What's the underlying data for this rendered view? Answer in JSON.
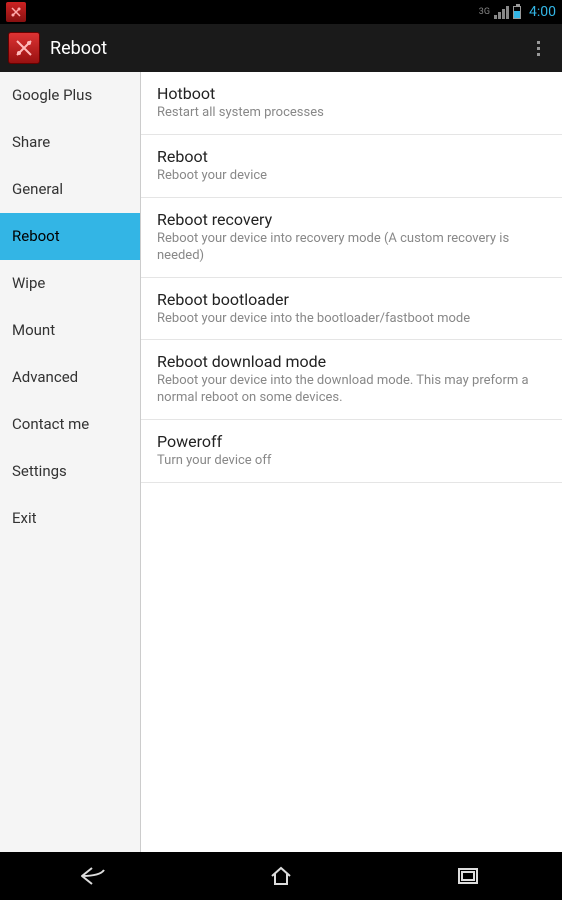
{
  "status": {
    "time": "4:00",
    "network_label": "3G"
  },
  "header": {
    "title": "Reboot"
  },
  "sidebar": {
    "items": [
      {
        "label": "Google Plus",
        "selected": false
      },
      {
        "label": "Share",
        "selected": false
      },
      {
        "label": "General",
        "selected": false
      },
      {
        "label": "Reboot",
        "selected": true
      },
      {
        "label": "Wipe",
        "selected": false
      },
      {
        "label": "Mount",
        "selected": false
      },
      {
        "label": "Advanced",
        "selected": false
      },
      {
        "label": "Contact me",
        "selected": false
      },
      {
        "label": "Settings",
        "selected": false
      },
      {
        "label": "Exit",
        "selected": false
      }
    ]
  },
  "main": {
    "items": [
      {
        "title": "Hotboot",
        "subtitle": "Restart all system processes"
      },
      {
        "title": "Reboot",
        "subtitle": "Reboot your device"
      },
      {
        "title": "Reboot recovery",
        "subtitle": "Reboot your device into recovery mode (A custom recovery is needed)"
      },
      {
        "title": "Reboot bootloader",
        "subtitle": "Reboot your device into the bootloader/fastboot mode"
      },
      {
        "title": "Reboot download mode",
        "subtitle": "Reboot your device into the download mode. This may preform a normal reboot on some devices."
      },
      {
        "title": "Poweroff",
        "subtitle": "Turn your device off"
      }
    ]
  }
}
